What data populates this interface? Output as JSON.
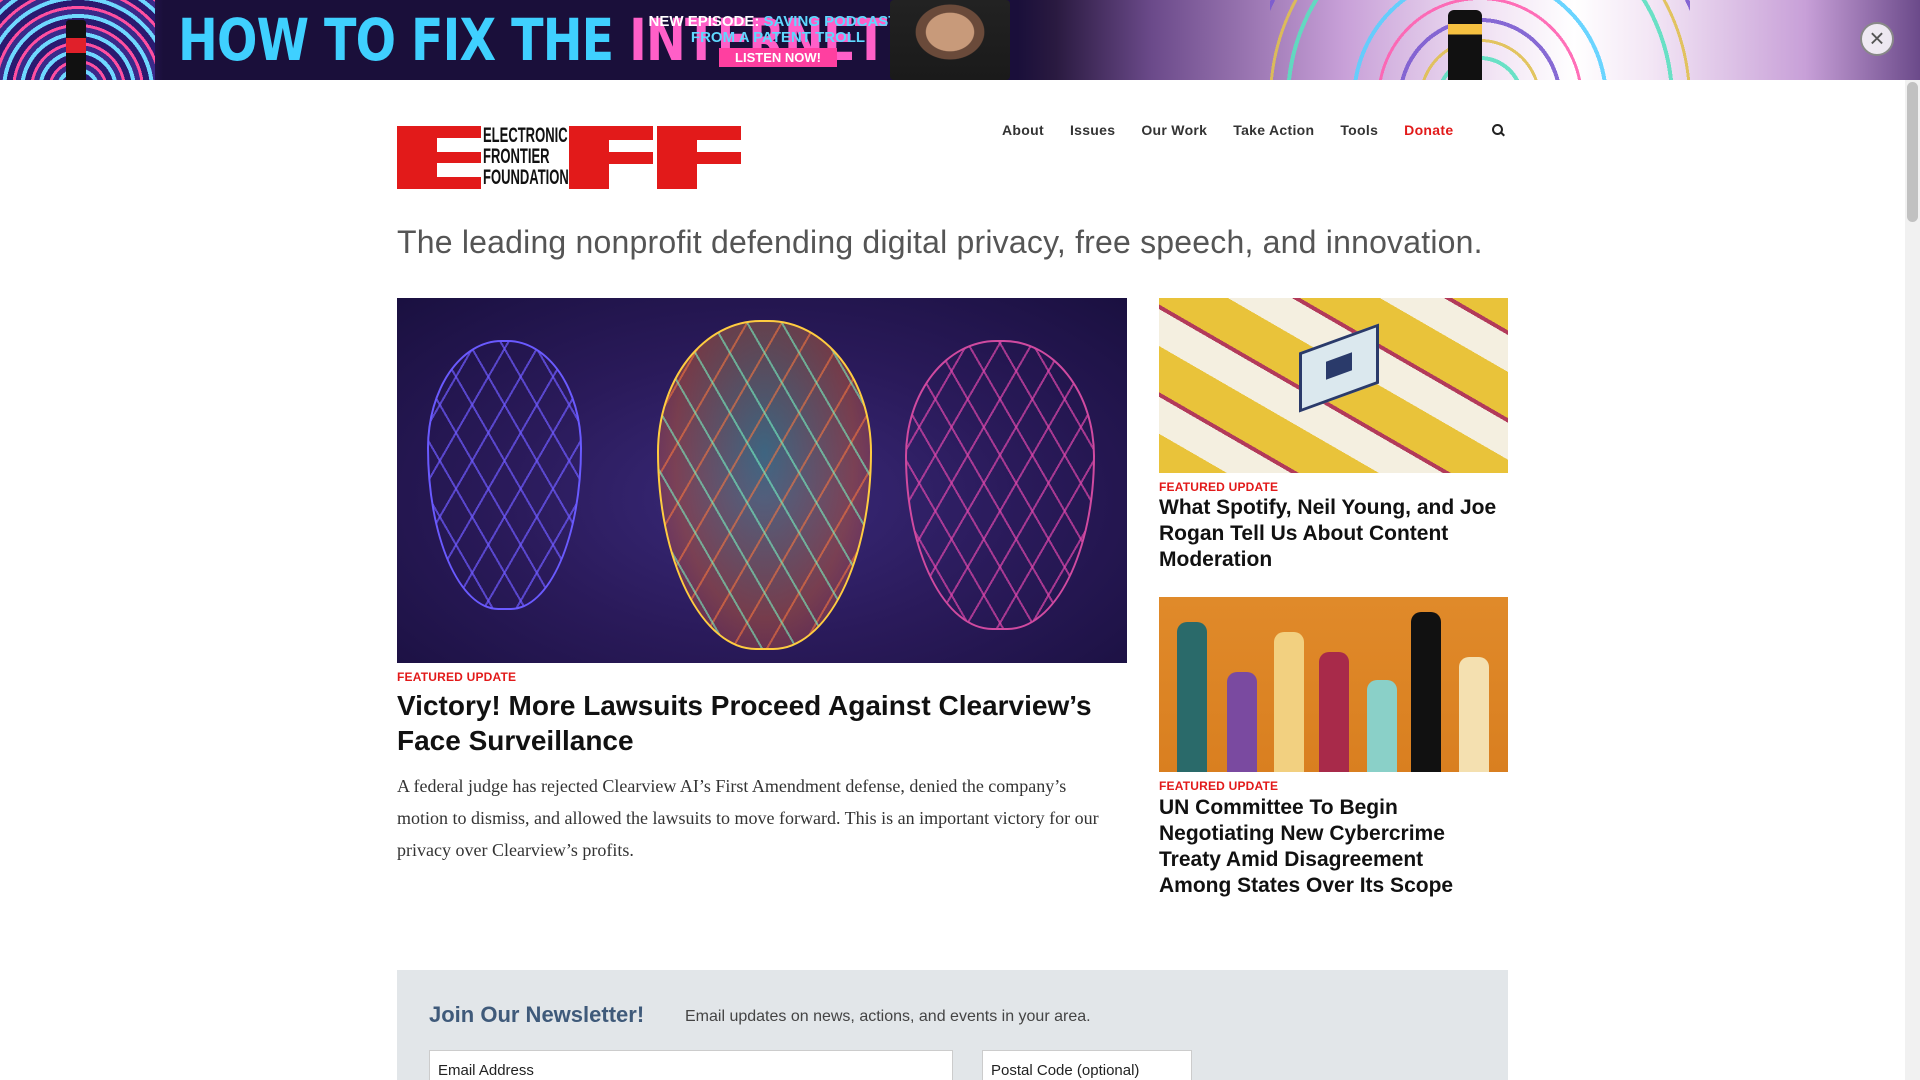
{
  "banner": {
    "headline_part1": "HOW TO FIX THE ",
    "headline_part2": "INTERNET",
    "promo_line1_prefix": "NEW EPISODE: ",
    "promo_line1_highlight": "SAVING PODCASTS",
    "promo_line2": "FROM A PATENT TROLL",
    "cta": "LISTEN NOW!",
    "close_glyph": "×"
  },
  "logo": {
    "line1": "ELECTRONIC",
    "line2": "FRONTIER",
    "line3": "FOUNDATION",
    "brand_color": "#e21a1a"
  },
  "nav": {
    "items": [
      {
        "label": "About"
      },
      {
        "label": "Issues"
      },
      {
        "label": "Our Work"
      },
      {
        "label": "Take Action"
      },
      {
        "label": "Tools"
      },
      {
        "label": "Donate",
        "color": "#e21a1a"
      }
    ],
    "search_icon": "search-icon"
  },
  "tagline": "The leading nonprofit defending digital privacy, free speech, and innovation.",
  "featured_main": {
    "kicker": "FEATURED UPDATE",
    "title": "Victory! More Lawsuits Proceed Against Clearview’s Face Surveillance",
    "body": "A federal judge has rejected Clearview AI’s First Amendment defense, denied the company’s motion to dismiss, and allowed the lawsuits to move forward. This is an important victory for our privacy over Clearview’s profits."
  },
  "featured_side": [
    {
      "kicker": "FEATURED UPDATE",
      "title": "What Spotify, Neil Young, and Joe Rogan Tell Us About Content Moderation"
    },
    {
      "kicker": "FEATURED UPDATE",
      "title": "UN Committee To Begin Negotiating New Cybercrime Treaty Amid Disagreement Among States Over Its Scope"
    }
  ],
  "newsletter": {
    "title": "Join Our Newsletter!",
    "description": "Email updates on news, actions, and events in your area.",
    "email_placeholder": "Email Address",
    "zip_placeholder": "Postal Code (optional)"
  }
}
